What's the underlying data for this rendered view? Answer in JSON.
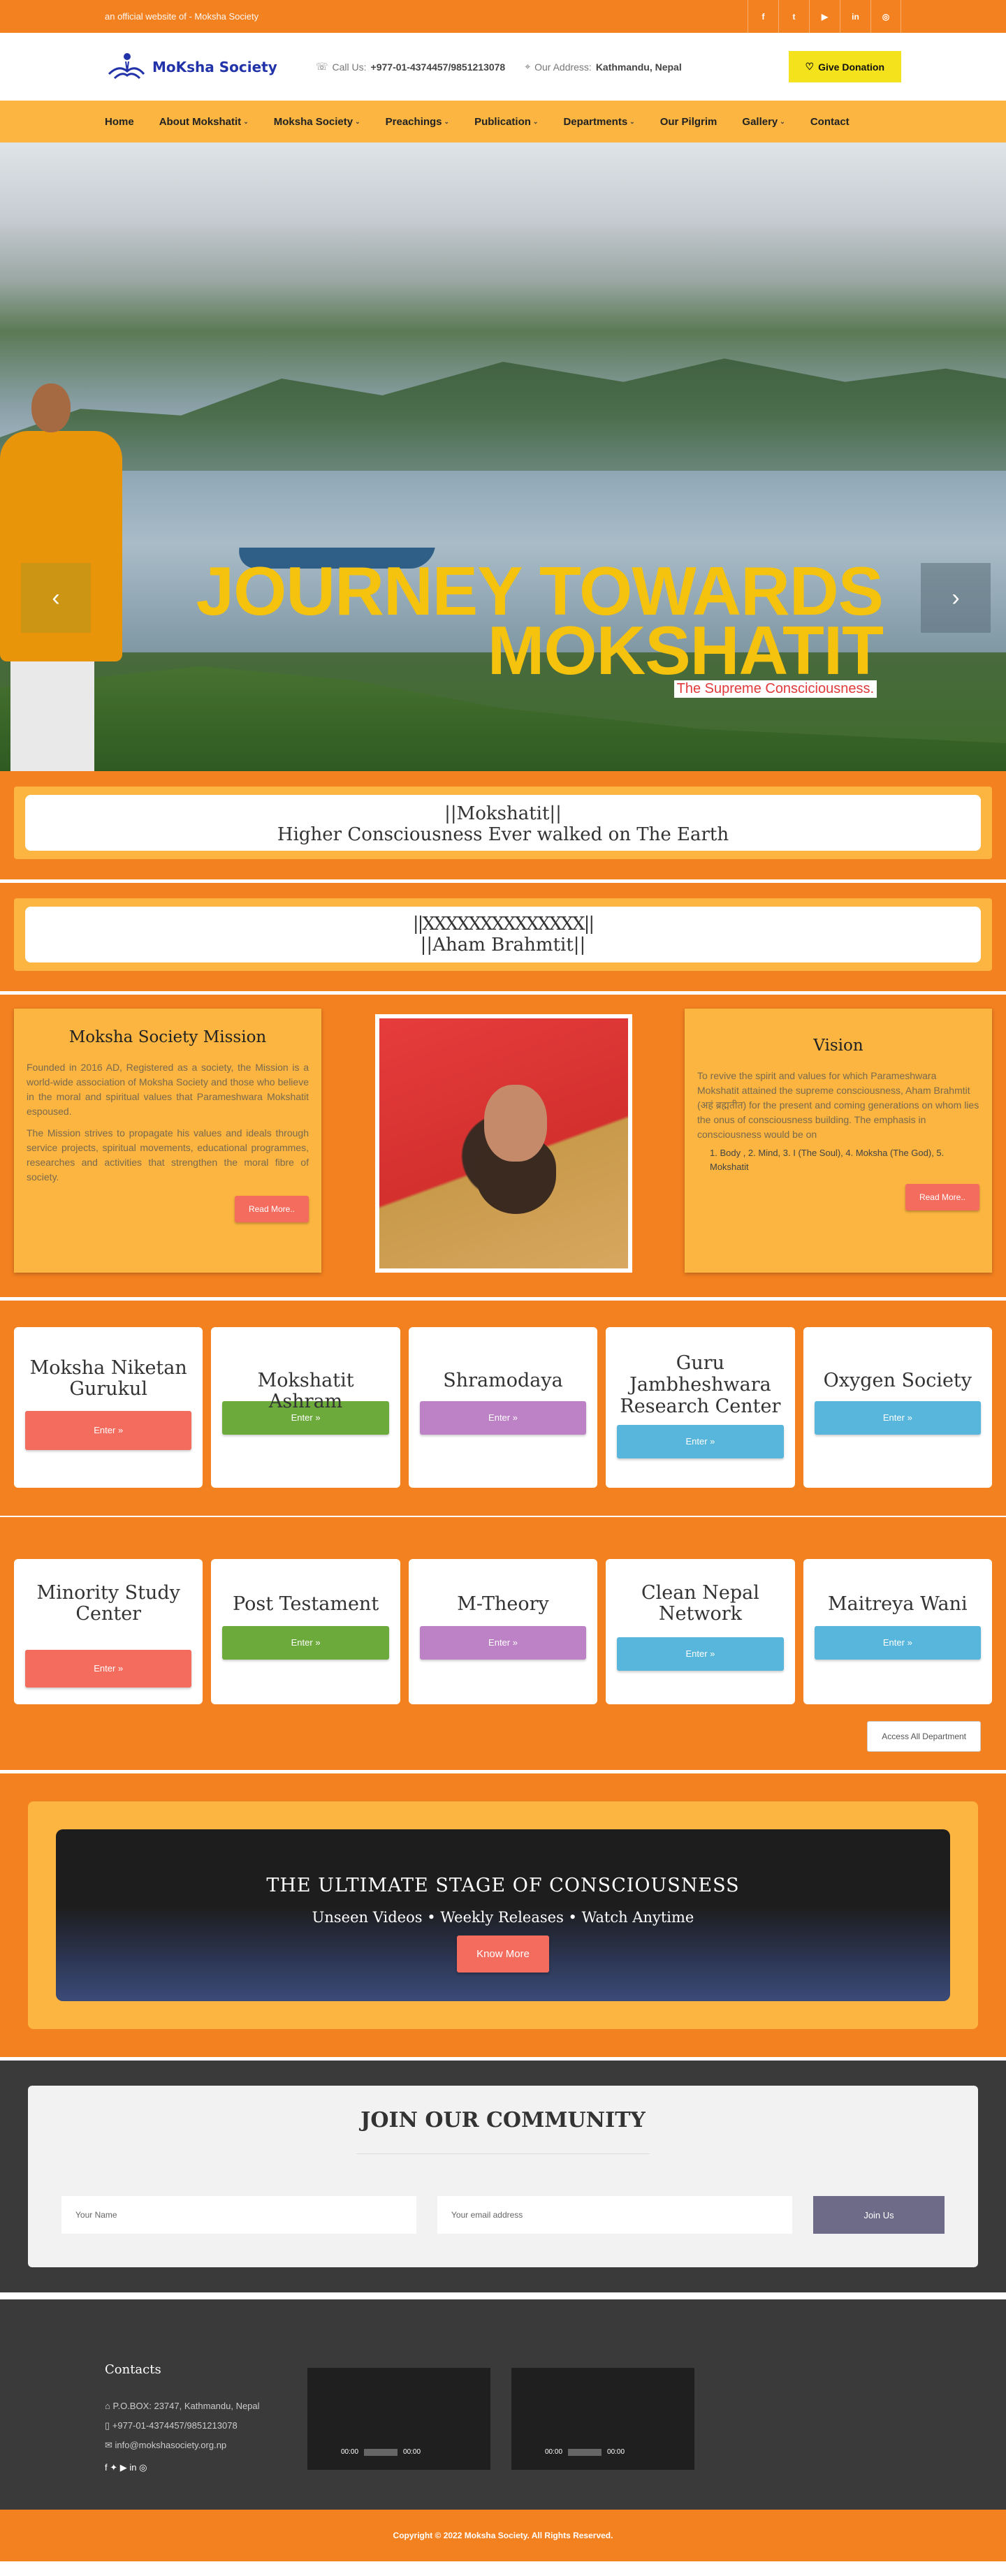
{
  "topbar": {
    "tagline": "an official website of - Moksha Society",
    "social": [
      "f",
      "t",
      "▶",
      "in",
      "◎"
    ]
  },
  "header": {
    "logo_text": "MoKsha Society",
    "call_label": "Call Us:",
    "call_value": "+977-01-4374457/9851213078",
    "address_label": "Our Address:",
    "address_value": "Kathmandu, Nepal",
    "donate_label": "Give Donation"
  },
  "nav": {
    "items": [
      {
        "label": "Home"
      },
      {
        "label": "About Mokshatit"
      },
      {
        "label": "Moksha Society"
      },
      {
        "label": "Preachings"
      },
      {
        "label": "Publication"
      },
      {
        "label": "Departments"
      },
      {
        "label": "Our Pilgrim"
      },
      {
        "label": "Gallery"
      },
      {
        "label": "Contact"
      }
    ]
  },
  "hero": {
    "title_line1": "JOURNEY TOWARDS",
    "title_line2": "MOKSHATIT",
    "subtitle": "The Supreme Consciciousness.",
    "prev": "‹",
    "next": "›",
    "slides": 5,
    "active": 0
  },
  "band1": {
    "line1": "||Mokshatit||",
    "line2": "Higher Consciousness Ever walked on The Earth"
  },
  "band2": {
    "line1": "||XXXXXXXXXXXXXX||",
    "line2": "||Aham Brahmtit||"
  },
  "mission": {
    "title": "Moksha Society Mission",
    "p1": "Founded in 2016 AD, Registered as a society, the Mission is a world-wide association of Moksha Society and those who believe in the moral and spiritual values that Parameshwara Mokshatit espoused.",
    "p2": "The Mission strives to propagate his values and ideals through service projects, spiritual movements, educational programmes, researches and activities that strengthen the moral fibre of society.",
    "btn": "Read More.."
  },
  "vision": {
    "title": "Vision",
    "p1": "To revive the spirit and values for which Parameshwara Mokshatit attained the supreme consciousness, Aham Brahmtit (अहं ब्रह्मतीत) for the present and coming generations on whom lies the onus of consciousness building. The emphasis in consciousness would be on",
    "list": "1. Body , 2. Mind, 3. I (The Soul), 4. Moksha (The God), 5. Mokshatit",
    "btn": "Read More.."
  },
  "departments": {
    "row1": [
      {
        "name": "Moksha Niketan Gurukul",
        "btn": "Enter",
        "color": "#f36c5e"
      },
      {
        "name": "Mokshatit Ashram",
        "btn": "Enter",
        "color": "#6daa3c"
      },
      {
        "name": "Shramodaya",
        "btn": "Enter",
        "color": "#bd82c6"
      },
      {
        "name": "Guru Jambheshwara Research Center",
        "btn": "Enter",
        "color": "#58b6dc"
      },
      {
        "name": "Oxygen Society",
        "btn": "Enter",
        "color": "#58b6dc"
      }
    ],
    "row2": [
      {
        "name": "Minority Study Center",
        "btn": "Enter",
        "color": "#f36c5e"
      },
      {
        "name": "Post Testament",
        "btn": "Enter",
        "color": "#6daa3c"
      },
      {
        "name": "M-Theory",
        "btn": "Enter",
        "color": "#bd82c6"
      },
      {
        "name": "Clean Nepal Network",
        "btn": "Enter",
        "color": "#58b6dc"
      },
      {
        "name": "Maitreya Wani",
        "btn": "Enter",
        "color": "#58b6dc"
      }
    ],
    "access_label": "Access All Department"
  },
  "video": {
    "title": "THE ULTIMATE STAGE OF CONSCIOUSNESS",
    "subtitle": "Unseen Videos • Weekly Releases • Watch Anytime",
    "btn": "Know More"
  },
  "community": {
    "title": "JOIN OUR COMMUNITY",
    "name_placeholder": "Your Name",
    "email_placeholder": "Your email address",
    "join": "Join Us"
  },
  "footer": {
    "contacts_title": "Contacts",
    "pobox": "P.O.BOX: 23747, Kathmandu, Nepal",
    "phone": "+977-01-4374457/9851213078",
    "email": "info@mokshasociety.org.np",
    "social": "f  ✦  ▶  in  ◎",
    "video_time": "00:00",
    "copyright": "Copyright © 2022 Moksha Society. All Rights Reserved."
  }
}
